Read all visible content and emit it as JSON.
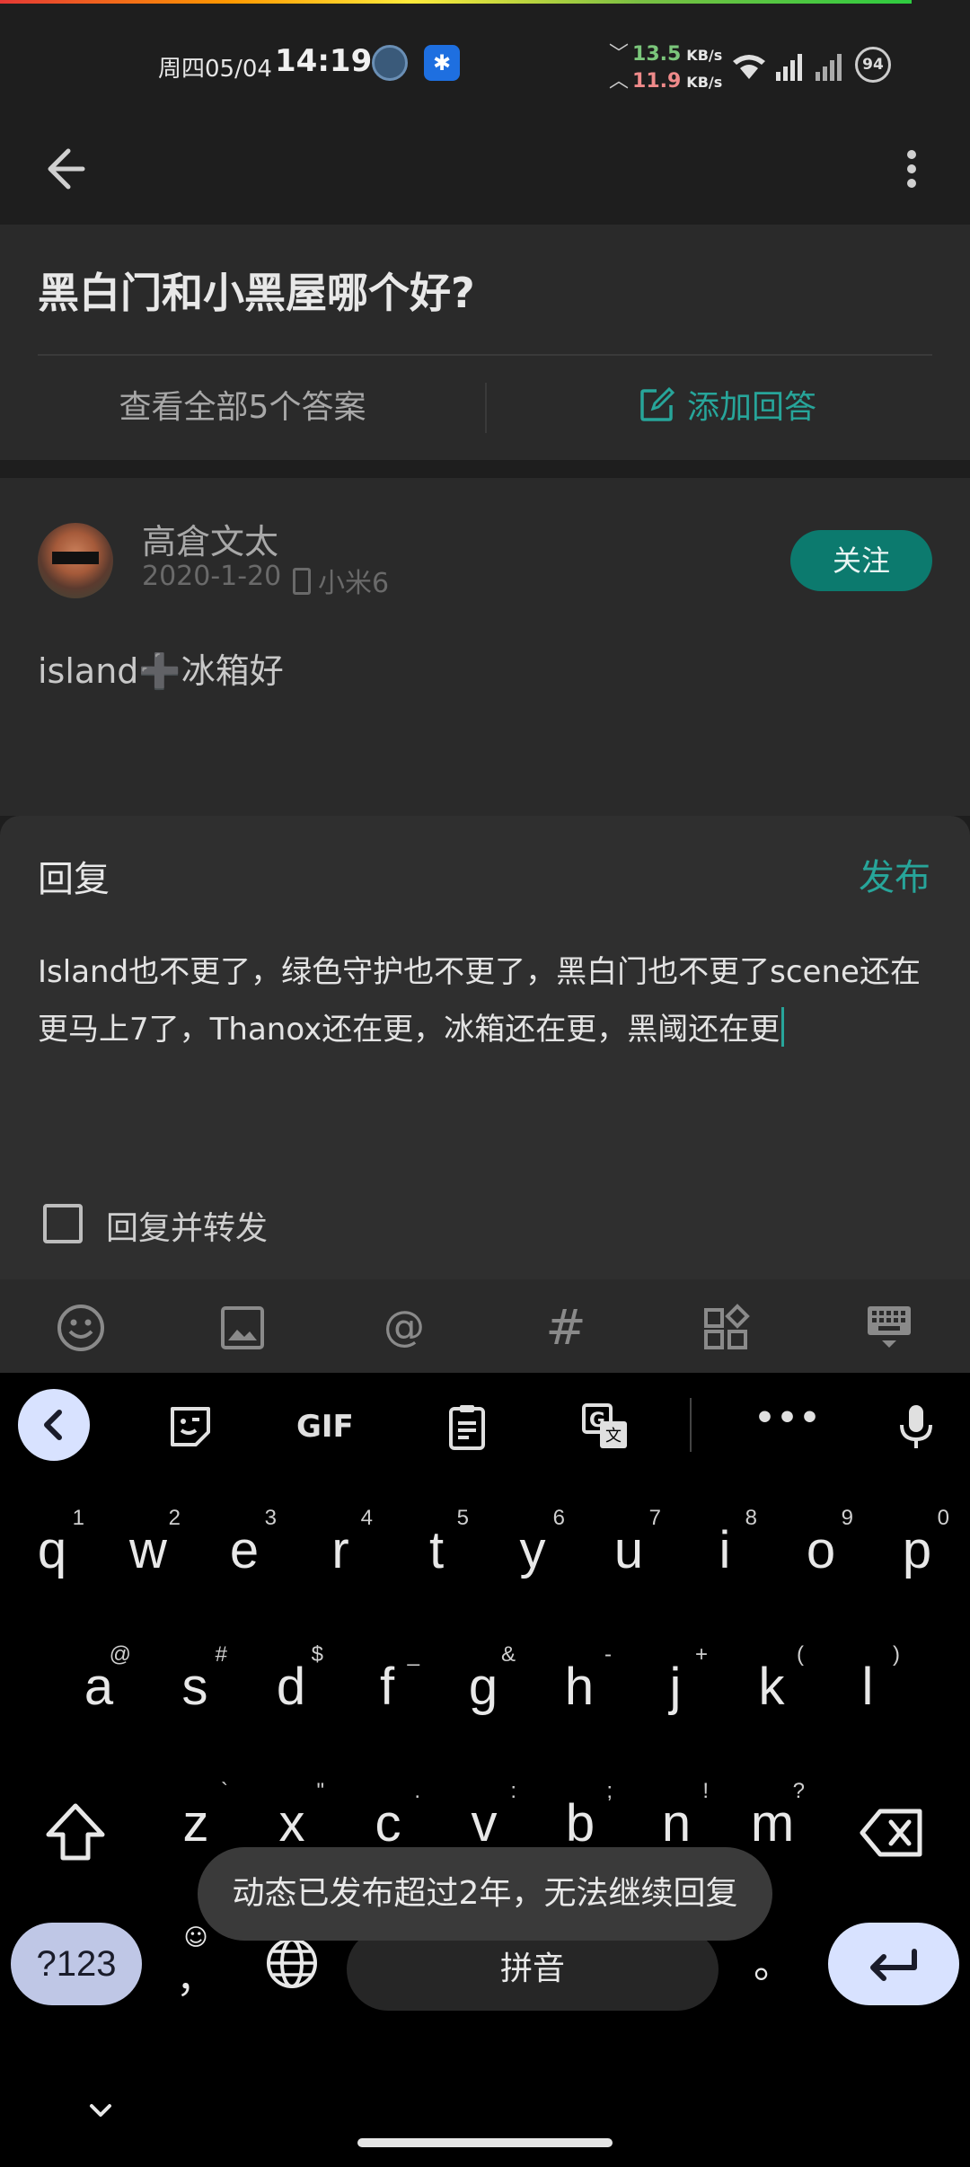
{
  "status_bar": {
    "date": "周四05/04",
    "time": "14:19",
    "download_speed": "13.5",
    "upload_speed": "11.9",
    "speed_unit": "KB/s",
    "battery": "94"
  },
  "question": {
    "title": "黑白门和小黑屋哪个好?",
    "view_all": "查看全部5个答案",
    "add_answer": "添加回答"
  },
  "answer": {
    "author": "高倉文太",
    "date": "2020-1-20",
    "device": "小米6",
    "follow_label": "关注",
    "content": "island➕冰箱好"
  },
  "reply": {
    "title": "回复",
    "publish_label": "发布",
    "text": "Island也不更了，绿色守护也不更了，黑白门也不更了scene还在更马上7了，Thanox还在更，冰箱还在更，黑阈还在更",
    "forward_label": "回复并转发"
  },
  "keyboard": {
    "gif_label": "GIF",
    "row1": [
      {
        "k": "q",
        "s": "1"
      },
      {
        "k": "w",
        "s": "2"
      },
      {
        "k": "e",
        "s": "3"
      },
      {
        "k": "r",
        "s": "4"
      },
      {
        "k": "t",
        "s": "5"
      },
      {
        "k": "y",
        "s": "6"
      },
      {
        "k": "u",
        "s": "7"
      },
      {
        "k": "i",
        "s": "8"
      },
      {
        "k": "o",
        "s": "9"
      },
      {
        "k": "p",
        "s": "0"
      }
    ],
    "row2": [
      {
        "k": "a",
        "s": "@"
      },
      {
        "k": "s",
        "s": "#"
      },
      {
        "k": "d",
        "s": "$"
      },
      {
        "k": "f",
        "s": "_"
      },
      {
        "k": "g",
        "s": "&"
      },
      {
        "k": "h",
        "s": "-"
      },
      {
        "k": "j",
        "s": "+"
      },
      {
        "k": "k",
        "s": "("
      },
      {
        "k": "l",
        "s": ")"
      }
    ],
    "row3": [
      {
        "k": "z",
        "s": "`"
      },
      {
        "k": "x",
        "s": "\""
      },
      {
        "k": "c",
        "s": "."
      },
      {
        "k": "v",
        "s": ":"
      },
      {
        "k": "b",
        "s": ";"
      },
      {
        "k": "n",
        "s": "!"
      },
      {
        "k": "m",
        "s": "?"
      }
    ],
    "symbols_label": "?123",
    "comma": "，",
    "space_label": "拼音",
    "period": "。"
  },
  "toast": "动态已发布超过2年，无法继续回复",
  "colors": {
    "accent": "#27a59a",
    "follow_bg": "#0c7a6e",
    "background": "#1e1e1e",
    "keyboard_bg": "#000000"
  }
}
